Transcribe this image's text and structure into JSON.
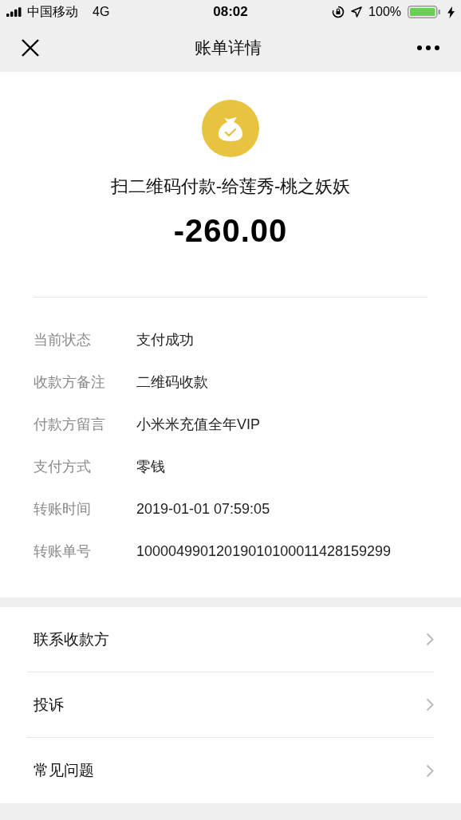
{
  "status_bar": {
    "carrier": "中国移动",
    "network": "4G",
    "time": "08:02",
    "battery": "100%"
  },
  "nav": {
    "title": "账单详情"
  },
  "summary": {
    "title": "扫二维码付款-给莲秀-桃之妖妖",
    "amount": "-260.00"
  },
  "details": [
    {
      "label": "当前状态",
      "value": "支付成功"
    },
    {
      "label": "收款方备注",
      "value": "二维码收款"
    },
    {
      "label": "付款方留言",
      "value": "小米米充值全年VIP"
    },
    {
      "label": "支付方式",
      "value": "零钱"
    },
    {
      "label": "转账时间",
      "value": "2019-01-01 07:59:05"
    },
    {
      "label": "转账单号",
      "value": "10000499012019010100011428159299"
    }
  ],
  "menu": [
    {
      "label": "联系收款方"
    },
    {
      "label": "投诉"
    },
    {
      "label": "常见问题"
    }
  ]
}
